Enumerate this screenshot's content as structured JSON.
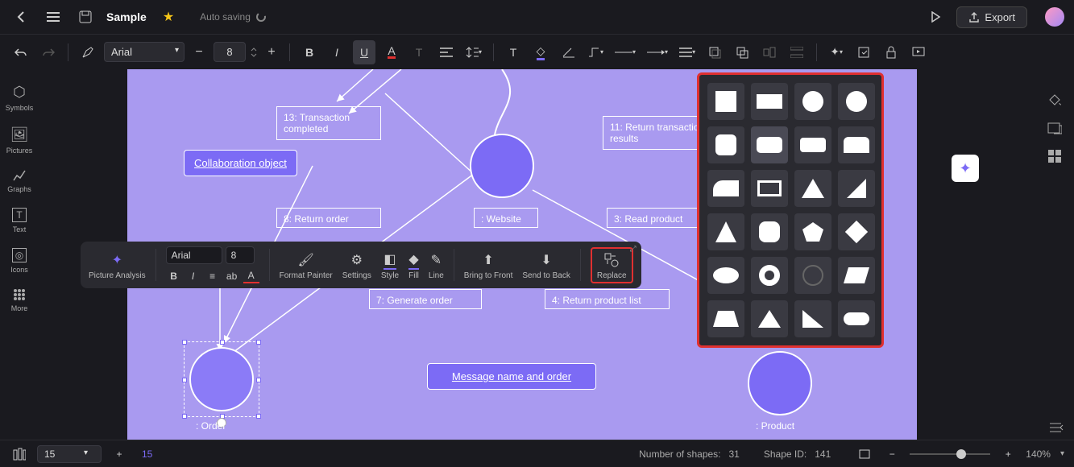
{
  "header": {
    "doc_title": "Sample",
    "autosave_text": "Auto saving",
    "export_label": "Export"
  },
  "toolbar": {
    "font": "Arial",
    "font_size": "8"
  },
  "left_sidebar": {
    "items": [
      {
        "icon": "⬡",
        "label": "Symbols"
      },
      {
        "icon": "🖼",
        "label": "Pictures"
      },
      {
        "icon": "📈",
        "label": "Graphs"
      },
      {
        "icon": "T",
        "label": "Text"
      },
      {
        "icon": "◎",
        "label": "Icons"
      },
      {
        "icon": "⋮⋮",
        "label": "More"
      }
    ]
  },
  "canvas": {
    "nodes": {
      "collab_label": "Collaboration object",
      "n13": "13: Transaction completed",
      "n11": "11: Return transaction results",
      "n8": "8: Return order",
      "website": ": Website",
      "n3": "3: Read product",
      "n7": "7: Generate order",
      "n4": "4: Return product list",
      "msg_label": "Message name and order",
      "order_label": ": Order",
      "product_label": ": Product"
    }
  },
  "ctx_toolbar": {
    "picture_analysis": "Picture Analysis",
    "font": "Arial",
    "font_size": "8",
    "format_painter": "Format Painter",
    "settings": "Settings",
    "style": "Style",
    "fill": "Fill",
    "line": "Line",
    "bring_front": "Bring to Front",
    "send_back": "Send to Back",
    "replace": "Replace"
  },
  "shape_picker": {
    "shapes": [
      "square",
      "rect-wide",
      "circle",
      "circle-solid",
      "round-rect",
      "round-rect-wide",
      "pill-rect",
      "tab-rect",
      "round-snip",
      "frame",
      "triangle",
      "right-tri-tall",
      "triangle-iso",
      "round-square",
      "pentagon",
      "diamond",
      "ellipse",
      "donut",
      "ring",
      "parallelogram",
      "trapezoid",
      "triangle2",
      "right-tri",
      "terminator"
    ]
  },
  "statusbar": {
    "page_select": "15",
    "page_number": "15",
    "shapes_count_label": "Number of shapes:",
    "shapes_count": "31",
    "shape_id_label": "Shape ID:",
    "shape_id": "141",
    "zoom_label": "140%"
  }
}
